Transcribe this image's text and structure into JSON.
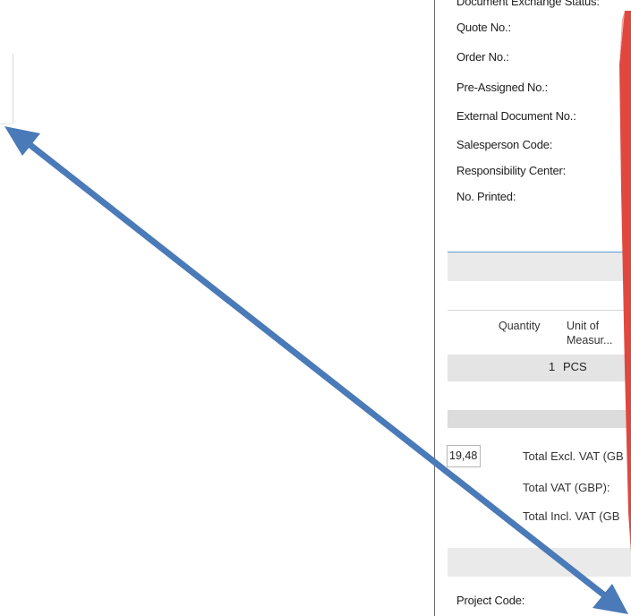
{
  "fields": [
    {
      "label": "Document Exchange Status:"
    },
    {
      "label": "Quote No.:"
    },
    {
      "label": "Order No.:"
    },
    {
      "label": "Pre-Assigned No.:"
    },
    {
      "label": "External Document No.:"
    },
    {
      "label": "Salesperson Code:"
    },
    {
      "label": "Responsibility Center:"
    },
    {
      "label": "No. Printed:"
    }
  ],
  "lines": {
    "columns": {
      "quantity": "Quantity",
      "unit_of_measure": "Unit of\nMeasur..."
    },
    "row": {
      "quantity": "1",
      "unit": "PCS"
    }
  },
  "totals": {
    "amount": "19,48",
    "excl_vat": "Total Excl. VAT (GB",
    "vat": "Total VAT (GBP):",
    "incl_vat": "Total Incl. VAT (GB"
  },
  "footer": {
    "project_code": "Project Code:"
  },
  "colors": {
    "arrow": "#4a7ab8",
    "red_accent": "#e0483f",
    "band": "#eaeaea",
    "link_line": "#5b9bd5"
  }
}
